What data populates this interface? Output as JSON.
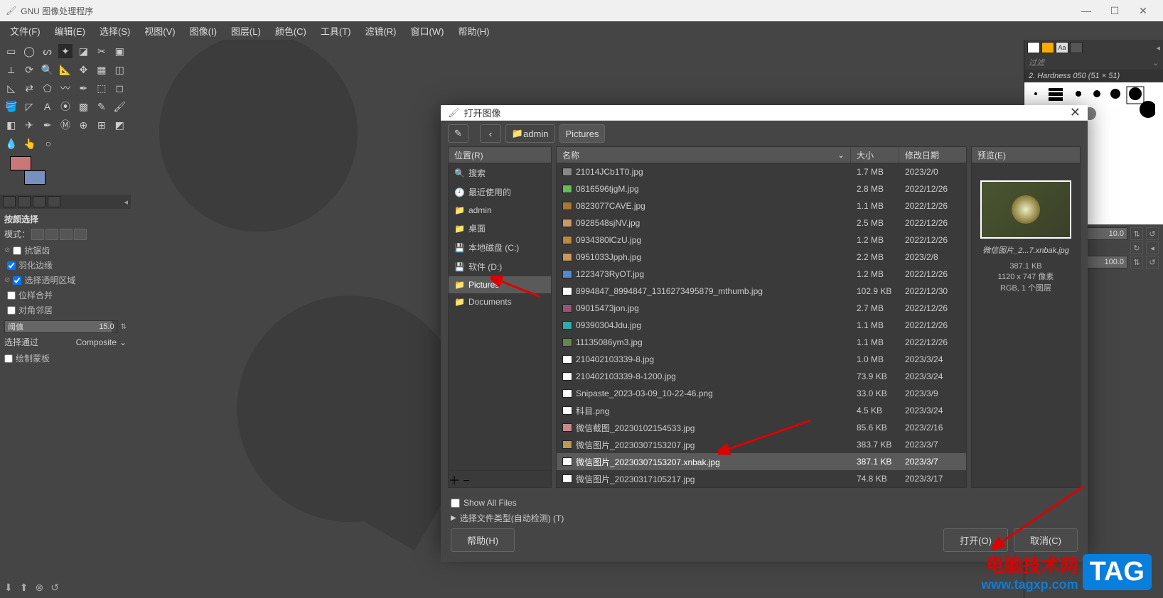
{
  "app": {
    "title": "GNU 图像处理程序"
  },
  "menu": [
    "文件(F)",
    "编辑(E)",
    "选择(S)",
    "视图(V)",
    "图像(I)",
    "图层(L)",
    "颜色(C)",
    "工具(T)",
    "滤镜(R)",
    "窗口(W)",
    "帮助(H)"
  ],
  "tool_options": {
    "title": "按颜选择",
    "mode_label": "模式：",
    "checks": [
      "抗锯齿",
      "羽化边缘",
      "选择透明区域",
      "位样合并",
      "对角邻居"
    ],
    "threshold_label": "阈值",
    "threshold_value": "15.0",
    "select_by_label": "选择通过",
    "select_by_value": "Composite",
    "mask_label": "绘制蒙板"
  },
  "brush_panel": {
    "filter_placeholder": "过滤",
    "brush_name": "2. Hardness 050 (51 × 51)",
    "size_value": "10.0",
    "pct_value": "100.0"
  },
  "dialog": {
    "title": "打开图像",
    "edit_icon": "✎",
    "back": "‹",
    "crumbs": [
      "admin",
      "Pictures"
    ],
    "sidebar_header": "位置(R)",
    "sidebar": [
      {
        "icon": "🔍",
        "label": "搜索"
      },
      {
        "icon": "🕘",
        "label": "最近使用的"
      },
      {
        "icon": "📁",
        "label": "admin"
      },
      {
        "icon": "📁",
        "label": "桌面"
      },
      {
        "icon": "💾",
        "label": "本地磁盘 (C:)"
      },
      {
        "icon": "💾",
        "label": "软件 (D:)"
      },
      {
        "icon": "📁",
        "label": "Pictures",
        "selected": true
      },
      {
        "icon": "📁",
        "label": "Documents"
      }
    ],
    "file_headers": {
      "name": "名称",
      "size": "大小",
      "date": "修改日期"
    },
    "files": [
      {
        "name": "21014JCb1T0.jpg",
        "size": "1.7 MB",
        "date": "2023/2/0",
        "thumb": "#888"
      },
      {
        "name": "0816596tjgM.jpg",
        "size": "2.8 MB",
        "date": "2022/12/26",
        "thumb": "#6b5"
      },
      {
        "name": "0823077CAVE.jpg",
        "size": "1.1 MB",
        "date": "2022/12/26",
        "thumb": "#a73"
      },
      {
        "name": "0928548sjNV.jpg",
        "size": "2.5 MB",
        "date": "2022/12/26",
        "thumb": "#c96"
      },
      {
        "name": "0934380lCzU.jpg",
        "size": "1.2 MB",
        "date": "2022/12/26",
        "thumb": "#b84"
      },
      {
        "name": "0951033Jpph.jpg",
        "size": "2.2 MB",
        "date": "2023/2/8",
        "thumb": "#c95"
      },
      {
        "name": "1223473RyOT.jpg",
        "size": "1.2 MB",
        "date": "2022/12/26",
        "thumb": "#58c"
      },
      {
        "name": "8994847_8994847_1316273495879_mthumb.jpg",
        "size": "102.9 KB",
        "date": "2022/12/30",
        "thumb": "#fff"
      },
      {
        "name": "09015473jon.jpg",
        "size": "2.7 MB",
        "date": "2022/12/26",
        "thumb": "#957"
      },
      {
        "name": "09390304Jdu.jpg",
        "size": "1.1 MB",
        "date": "2022/12/26",
        "thumb": "#3aa"
      },
      {
        "name": "11135086ym3.jpg",
        "size": "1.1 MB",
        "date": "2022/12/26",
        "thumb": "#684"
      },
      {
        "name": "210402103339-8.jpg",
        "size": "1.0 MB",
        "date": "2023/3/24",
        "thumb": "#fff"
      },
      {
        "name": "210402103339-8-1200.jpg",
        "size": "73.9 KB",
        "date": "2023/3/24",
        "thumb": "#fff"
      },
      {
        "name": "Snipaste_2023-03-09_10-22-46.png",
        "size": "33.0 KB",
        "date": "2023/3/9",
        "thumb": "#fff"
      },
      {
        "name": "科目.png",
        "size": "4.5 KB",
        "date": "2023/3/24",
        "thumb": "#fff"
      },
      {
        "name": "微信截图_20230102154533.jpg",
        "size": "85.6 KB",
        "date": "2023/2/16",
        "thumb": "#c88"
      },
      {
        "name": "微信图片_20230307153207.jpg",
        "size": "383.7 KB",
        "date": "2023/3/7",
        "thumb": "#b95"
      },
      {
        "name": "微信图片_20230307153207.xnbak.jpg",
        "size": "387.1 KB",
        "date": "2023/3/7",
        "selected": true,
        "thumb": "#fff"
      },
      {
        "name": "微信图片_20230317105217.jpg",
        "size": "74.8 KB",
        "date": "2023/3/17",
        "thumb": "#fff"
      }
    ],
    "preview_header": "预览(E)",
    "preview_caption": "微信图片_2...7.xnbak.jpg",
    "preview_meta": [
      "387.1 KB",
      "1120 x 747 像素",
      "RGB, 1 个图层"
    ],
    "show_all": "Show All Files",
    "file_type": "选择文件类型(自动检测) (T)",
    "help": "帮助(H)",
    "open": "打开(O)",
    "cancel": "取消(C)"
  },
  "watermark": {
    "line1": "电脑技术网",
    "line2": "www.tagxp.com",
    "tag": "TAG"
  }
}
